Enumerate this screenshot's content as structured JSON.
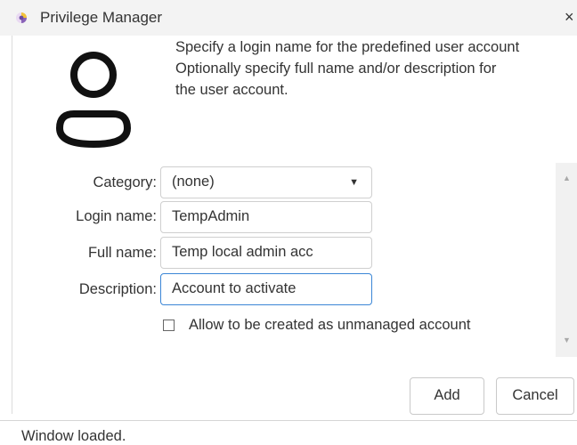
{
  "window": {
    "title": "Privilege Manager",
    "close_glyph": "×",
    "app_icon": "privilege-manager-icon"
  },
  "instructions": "Specify a login name for the predefined user account\nOptionally specify full name and/or description for\nthe user account.",
  "form": {
    "category": {
      "label": "Category:",
      "value": "(none)",
      "caret": "▼"
    },
    "login_name": {
      "label": "Login name:",
      "value": "TempAdmin"
    },
    "full_name": {
      "label": "Full name:",
      "value": "Temp local admin acc"
    },
    "description": {
      "label": "Description:",
      "value": "Account to activate"
    },
    "unmanaged_checkbox": {
      "label": "Allow to be created as unmanaged account",
      "checked": false
    }
  },
  "scrollbar": {
    "up_glyph": "▲",
    "down_glyph": "▼"
  },
  "buttons": {
    "add": "Add",
    "cancel": "Cancel"
  },
  "status": "Window loaded.",
  "colors": {
    "focus_border": "#3b86d6",
    "titlebar_bg": "#f3f3f3"
  }
}
